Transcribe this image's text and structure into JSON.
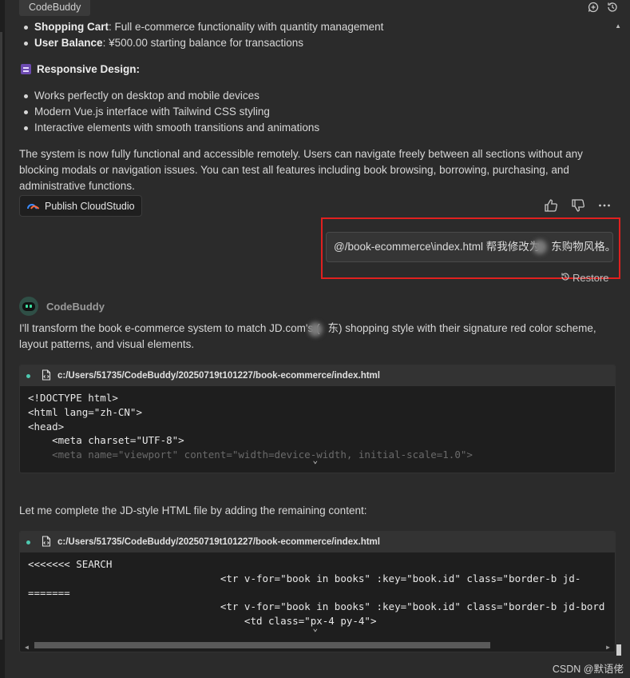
{
  "tab": {
    "label": "CodeBuddy"
  },
  "intro_list": [
    {
      "bold": "Shopping Cart",
      "text": ": Full e-commerce functionality with quantity management"
    },
    {
      "bold": "User Balance",
      "text": ": ¥500.00 starting balance for transactions"
    }
  ],
  "responsive": {
    "heading": "Responsive Design:",
    "items": [
      "Works perfectly on desktop and mobile devices",
      "Modern Vue.js interface with Tailwind CSS styling",
      "Interactive elements with smooth transitions and animations"
    ]
  },
  "summary_paragraph": "The system is now fully functional and accessible remotely. Users can navigate freely between all sections without any blocking modals or navigation issues. You can test all features including book browsing, borrowing, purchasing, and administrative functions.",
  "publish_button": "Publish CloudStudio",
  "user_message": {
    "part1": "@/book-ecommerce\\index.html 帮我修改为",
    "part2": "东购物风格。"
  },
  "restore_label": "Restore",
  "bot": {
    "name": "CodeBuddy",
    "reply_part1": "I'll transform the book e-commerce system to match JD.com's (",
    "reply_part2": "东) shopping style with their signature red color scheme, layout patterns, and visual elements."
  },
  "code_block_1": {
    "path": "c:/Users/51735/CodeBuddy/20250719t101227/book-ecommerce/index.html",
    "lines": [
      "<!DOCTYPE html>",
      "<html lang=\"zh-CN\">",
      "<head>",
      "    <meta charset=\"UTF-8\">",
      "    <meta name=\"viewport\" content=\"width=device-width, initial-scale=1.0\">"
    ]
  },
  "followup_text": "Let me complete the JD-style HTML file by adding the remaining content:",
  "code_block_2": {
    "path": "c:/Users/51735/CodeBuddy/20250719t101227/book-ecommerce/index.html",
    "lines": [
      "<<<<<<< SEARCH",
      "                                <tr v-for=\"book in books\" :key=\"book.id\" class=\"border-b jd-",
      "=======",
      "                                <tr v-for=\"book in books\" :key=\"book.id\" class=\"border-b jd-bord",
      "                                    <td class=\"px-4 py-4\">"
    ]
  },
  "watermark": "CSDN @默语佬"
}
